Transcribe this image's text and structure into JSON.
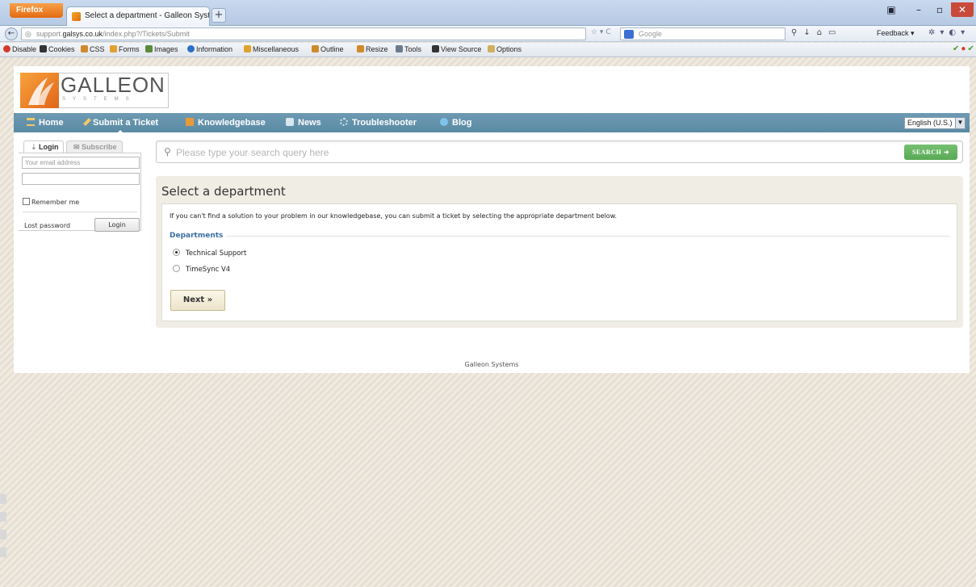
{
  "browser": {
    "app_button": "Firefox",
    "tab_title": "Select a department - Galleon Systems S...",
    "new_tab": "+",
    "url_prefix": "support.",
    "url_host": "galsys.co.uk",
    "url_path": "/index.php?/Tickets/Submit",
    "search_placeholder": "Google",
    "feedback_label": "Feedback",
    "win_min": "–",
    "win_max": "▫",
    "win_close": "✕"
  },
  "devbar": {
    "items": [
      "Disable",
      "Cookies",
      "CSS",
      "Forms",
      "Images",
      "Information",
      "Miscellaneous",
      "Outline",
      "Resize",
      "Tools",
      "View Source",
      "Options"
    ]
  },
  "site": {
    "logo_name": "GALLEON",
    "logo_sub": "SYSTEMS"
  },
  "menu": {
    "items": [
      "Home",
      "Submit a Ticket",
      "Knowledgebase",
      "News",
      "Troubleshooter",
      "Blog"
    ],
    "language": "English (U.S.)"
  },
  "sidebar": {
    "tab_login": "Login",
    "tab_subscribe": "Subscribe",
    "email_placeholder": "Your email address",
    "remember_label": "Remember me",
    "lost_password": "Lost password",
    "login_button": "Login"
  },
  "search": {
    "placeholder": "Please type your search query here",
    "button": "SEARCH"
  },
  "main": {
    "title": "Select a department",
    "intro": "If you can't find a solution to your problem in our knowledgebase, you can submit a ticket by selecting the appropriate department below.",
    "legend": "Departments",
    "departments": [
      {
        "label": "Technical Support",
        "selected": true
      },
      {
        "label": "TimeSync V4",
        "selected": false
      }
    ],
    "next_button": "Next »"
  },
  "footer": {
    "text": "Galleon Systems"
  },
  "colors": {
    "menubar": "#6e9ab2",
    "search_button": "#66b563",
    "accent_orange": "#e8781e",
    "legend_blue": "#3a6fa6"
  }
}
